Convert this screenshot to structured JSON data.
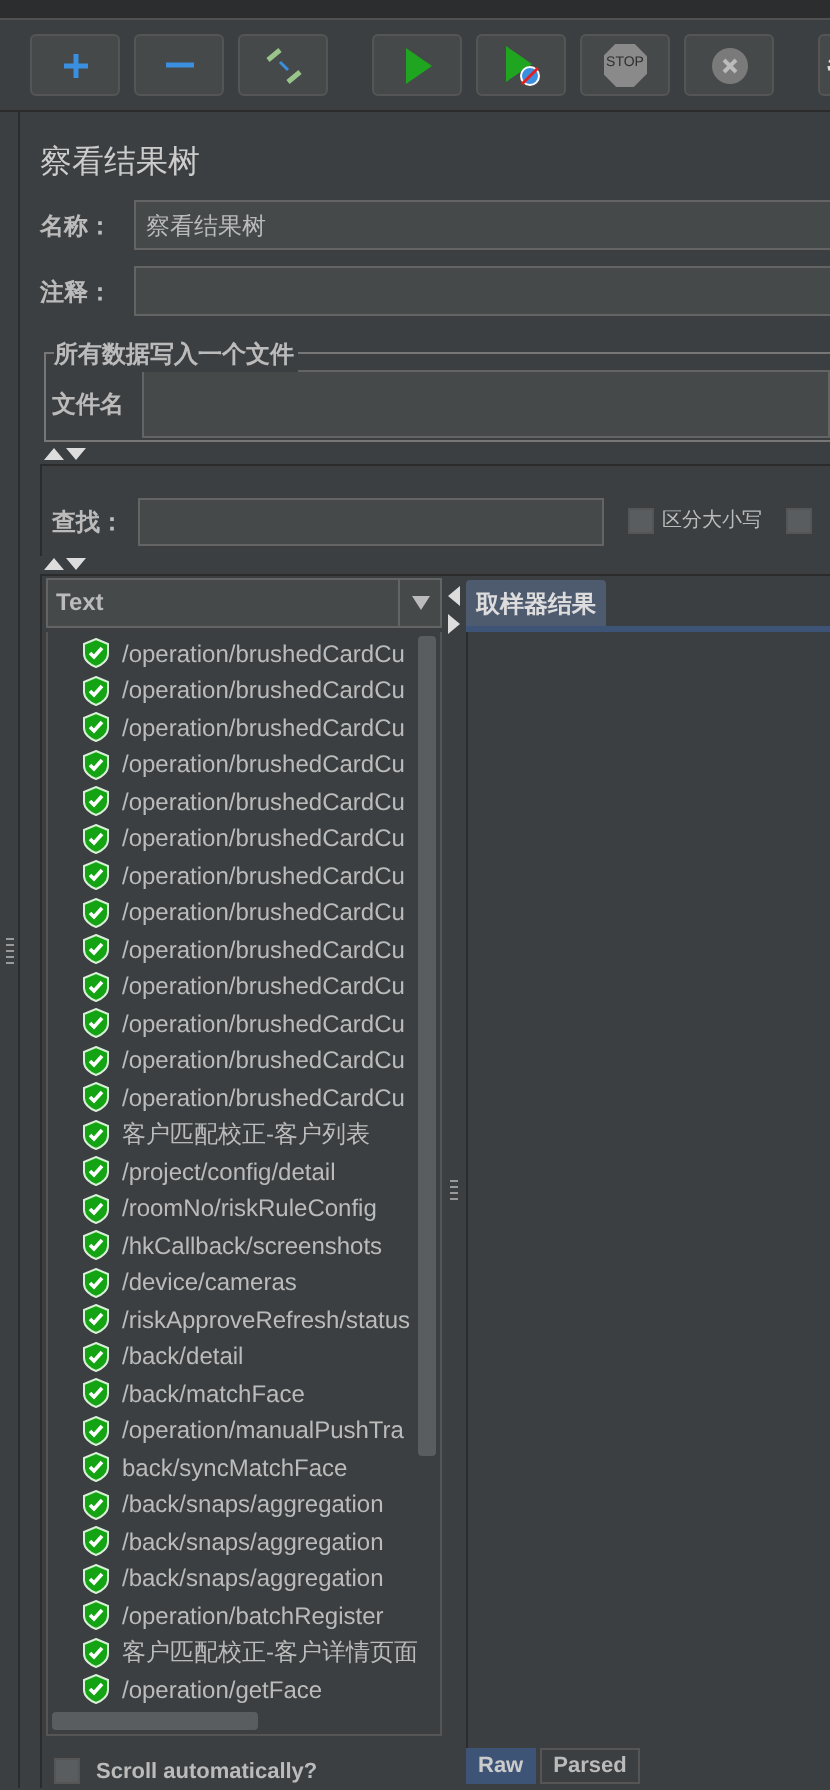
{
  "toolbar": {
    "buttons": [
      {
        "kind": "add"
      },
      {
        "kind": "remove"
      },
      {
        "kind": "toggle"
      },
      {
        "kind": "start"
      },
      {
        "kind": "start_no_pause"
      },
      {
        "kind": "stop",
        "label": "STOP",
        "disabled": true
      },
      {
        "kind": "shutdown",
        "disabled": true
      },
      {
        "kind": "settings"
      }
    ]
  },
  "panel": {
    "title": "察看结果树",
    "name_label": "名称：",
    "name_value": "察看结果树",
    "comment_label": "注释：",
    "file_group": {
      "legend": "所有数据写入一个文件",
      "filename_label": "文件名"
    },
    "search": {
      "label": "查找：",
      "options": [
        {
          "label": "区分大小写",
          "checked": false
        },
        {
          "checked": false
        }
      ]
    },
    "renderer": {
      "value": "Text"
    },
    "results": [
      {
        "label": "/operation/brushedCardCu",
        "success": true
      },
      {
        "label": "/operation/brushedCardCu",
        "success": true
      },
      {
        "label": "/operation/brushedCardCu",
        "success": true
      },
      {
        "label": "/operation/brushedCardCu",
        "success": true
      },
      {
        "label": "/operation/brushedCardCu",
        "success": true
      },
      {
        "label": "/operation/brushedCardCu",
        "success": true
      },
      {
        "label": "/operation/brushedCardCu",
        "success": true
      },
      {
        "label": "/operation/brushedCardCu",
        "success": true
      },
      {
        "label": "/operation/brushedCardCu",
        "success": true
      },
      {
        "label": "/operation/brushedCardCu",
        "success": true
      },
      {
        "label": "/operation/brushedCardCu",
        "success": true
      },
      {
        "label": "/operation/brushedCardCu",
        "success": true
      },
      {
        "label": "/operation/brushedCardCu",
        "success": true
      },
      {
        "label": "客户匹配校正-客户列表",
        "success": true
      },
      {
        "label": "/project/config/detail",
        "success": true
      },
      {
        "label": "/roomNo/riskRuleConfig",
        "success": true
      },
      {
        "label": "/hkCallback/screenshots",
        "success": true
      },
      {
        "label": "/device/cameras",
        "success": true
      },
      {
        "label": "/riskApproveRefresh/status",
        "success": true
      },
      {
        "label": "/back/detail",
        "success": true
      },
      {
        "label": "/back/matchFace",
        "success": true
      },
      {
        "label": "/operation/manualPushTra",
        "success": true
      },
      {
        "label": "back/syncMatchFace",
        "success": true
      },
      {
        "label": "/back/snaps/aggregation",
        "success": true
      },
      {
        "label": "/back/snaps/aggregation",
        "success": true
      },
      {
        "label": "/back/snaps/aggregation",
        "success": true
      },
      {
        "label": "/operation/batchRegister",
        "success": true
      },
      {
        "label": "客户匹配校正-客户详情页面",
        "success": true
      },
      {
        "label": "/operation/getFace",
        "success": true
      }
    ],
    "auto_scroll": {
      "label": "Scroll automatically?",
      "checked": false
    },
    "result_tabs": [
      {
        "label": "取样器结果",
        "selected": true
      }
    ],
    "body_tabs": [
      {
        "label": "Raw",
        "selected": true
      },
      {
        "label": "Parsed",
        "selected": false
      }
    ]
  }
}
